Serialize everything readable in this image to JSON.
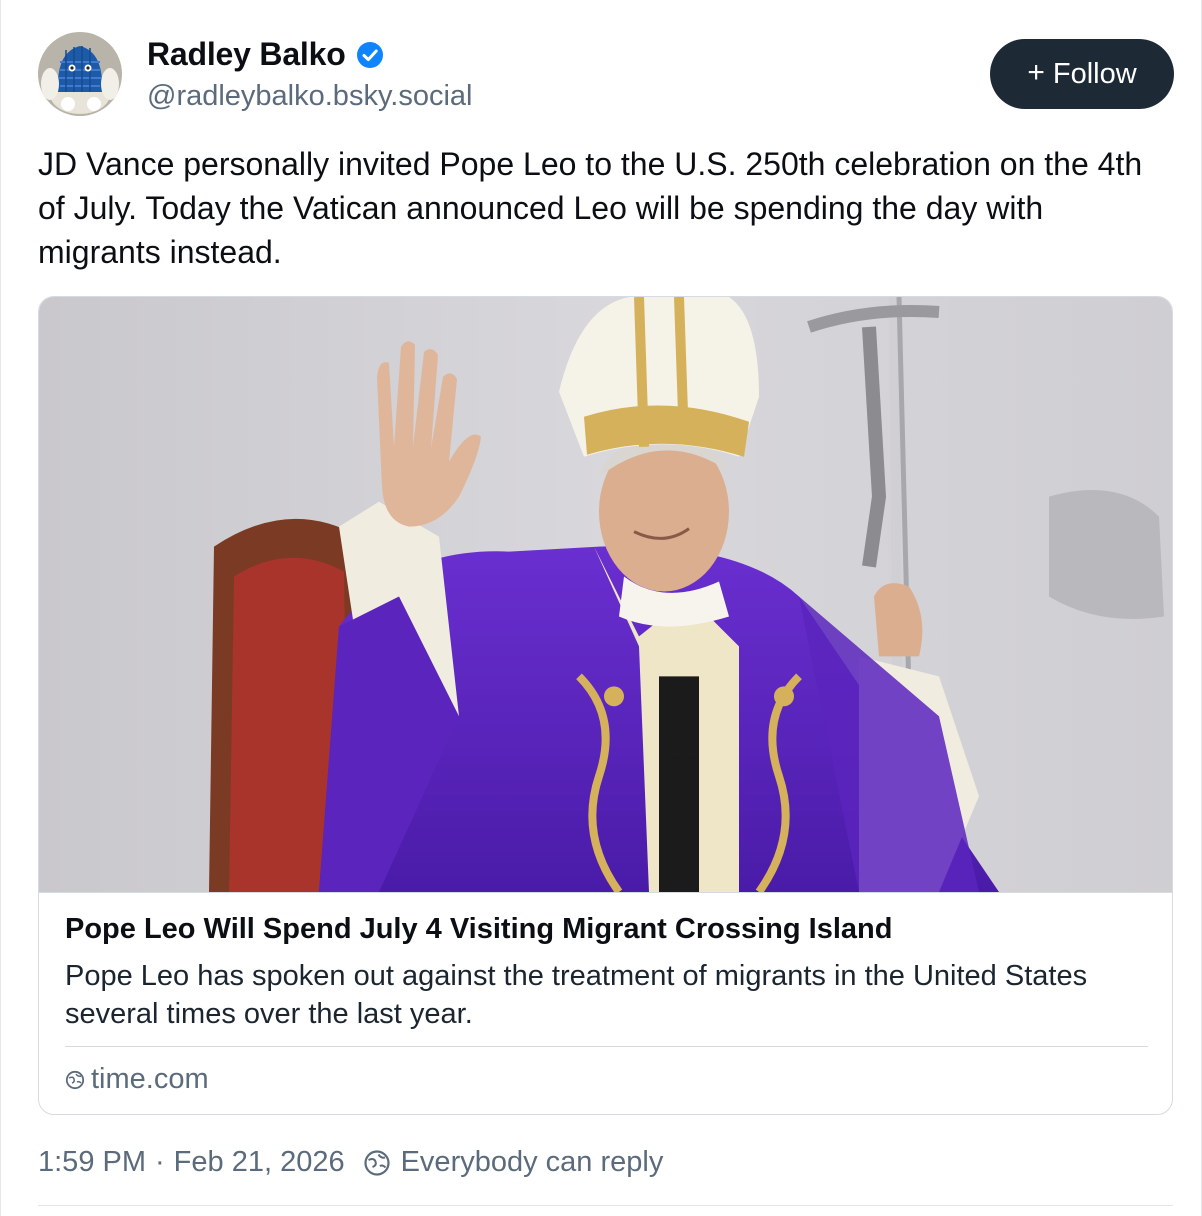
{
  "author": {
    "display_name": "Radley Balko",
    "handle": "@radleybalko.bsky.social",
    "verified": true
  },
  "follow_button": {
    "label": "Follow"
  },
  "post": {
    "text": "JD Vance personally invited Pope Leo to the U.S. 250th celebration on the 4th of July. Today the Vatican announced Leo will be spending the day with migrants instead."
  },
  "link_card": {
    "title": "Pope Leo Will Spend July 4 Visiting Migrant Crossing Island",
    "description": "Pope Leo has spoken out against the treatment of migrants in the United States several times over the last year.",
    "domain": "time.com",
    "image_icon": "photo-pope-waving"
  },
  "meta": {
    "time": "1:59 PM",
    "separator": "·",
    "date": "Feb 21, 2026",
    "reply_setting": "Everybody can reply"
  },
  "colors": {
    "accent_blue": "#1083fe",
    "follow_bg": "#1e2936",
    "muted_text": "#5b6b7c",
    "border": "#d4dbe2"
  }
}
